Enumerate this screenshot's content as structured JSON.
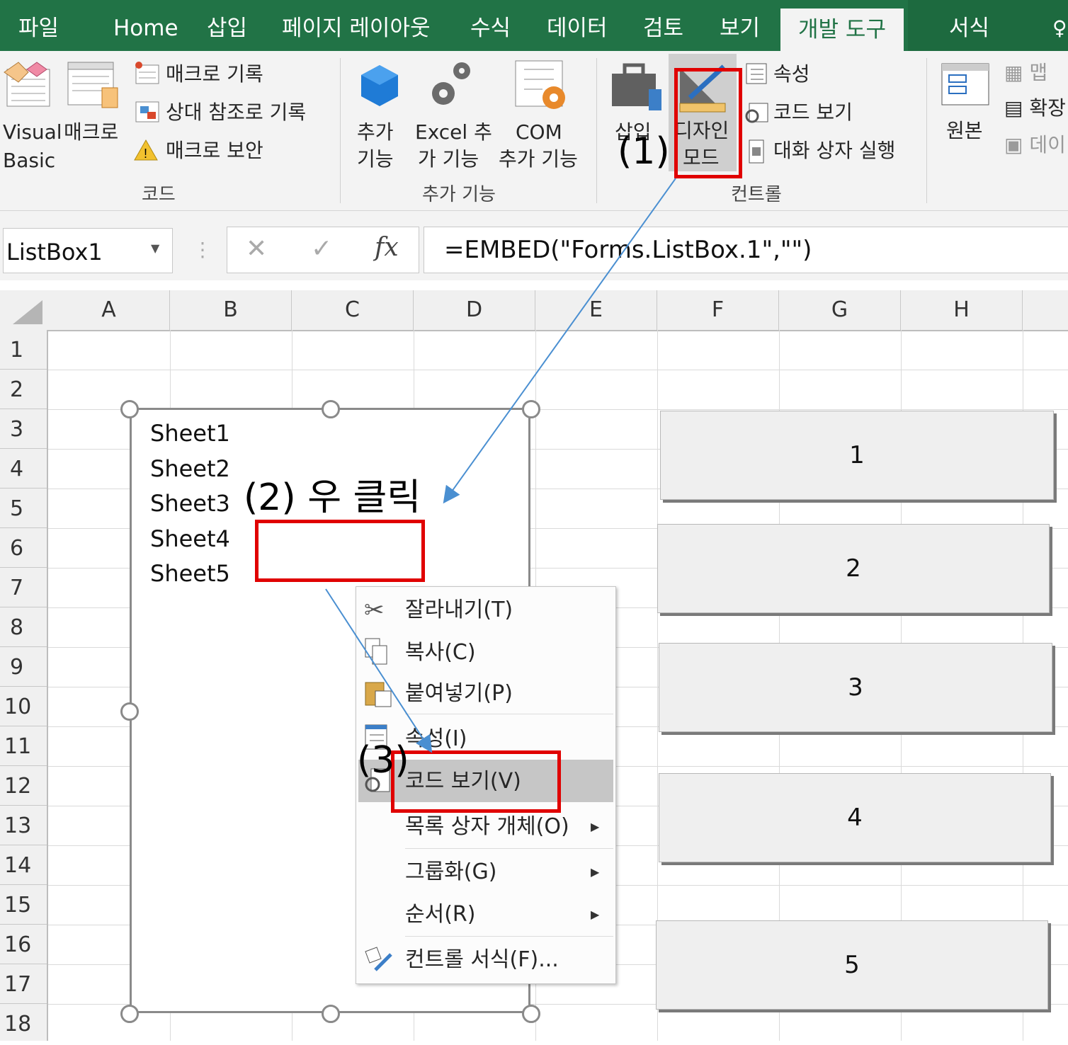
{
  "tabs": [
    "파일",
    "Home",
    "삽입",
    "페이지 레이아웃",
    "수식",
    "데이터",
    "검토",
    "보기",
    "개발 도구",
    "서식"
  ],
  "ribbon": {
    "code": {
      "visual_basic": [
        "Visual",
        "Basic"
      ],
      "macro": "매크로",
      "record_macro": "매크로 기록",
      "relative_ref": "상대 참조로 기록",
      "macro_security": "매크로 보안",
      "group": "코드"
    },
    "addins": {
      "addins": [
        "추가",
        "기능"
      ],
      "excel_addins": [
        "Excel 추",
        "가 기능"
      ],
      "com_addins": [
        "COM",
        "추가 기능"
      ],
      "group": "추가 기능"
    },
    "controls": {
      "insert": "삽입",
      "design_mode": [
        "디자인",
        "모드"
      ],
      "properties": "속성",
      "view_code": "코드 보기",
      "run_dialog": "대화 상자 실행",
      "group": "컨트롤"
    },
    "xml": {
      "source": "원본",
      "map": "맵",
      "expand": "확장",
      "data": "데이"
    }
  },
  "formula_bar": {
    "name_box": "ListBox1",
    "fx": "fx",
    "formula": "=EMBED(\"Forms.ListBox.1\",\"\")"
  },
  "grid": {
    "columns": [
      "A",
      "B",
      "C",
      "D",
      "E",
      "F",
      "G",
      "H"
    ],
    "rows": [
      "1",
      "2",
      "3",
      "4",
      "5",
      "6",
      "7",
      "8",
      "9",
      "10",
      "11",
      "12",
      "13",
      "14",
      "15",
      "16",
      "17",
      "18"
    ]
  },
  "listbox_items": [
    "Sheet1",
    "Sheet2",
    "Sheet3",
    "Sheet4",
    "Sheet5"
  ],
  "buttons": [
    "1",
    "2",
    "3",
    "4",
    "5"
  ],
  "context_menu": {
    "cut": "잘라내기(T)",
    "copy": "복사(C)",
    "paste": "붙여넣기(P)",
    "properties": "속성(I)",
    "view_code": "코드 보기(V)",
    "listbox_object": "목록 상자 개체(O)",
    "group": "그룹화(G)",
    "order": "순서(R)",
    "format_control": "컨트롤 서식(F)..."
  },
  "annotations": {
    "step1": "(1)",
    "step2": "(2) 우 클릭",
    "step3": "(3)"
  },
  "colors": {
    "ribbon_green": "#217346",
    "highlight_red": "#e00000",
    "arrow_blue": "#4a8fd1"
  }
}
